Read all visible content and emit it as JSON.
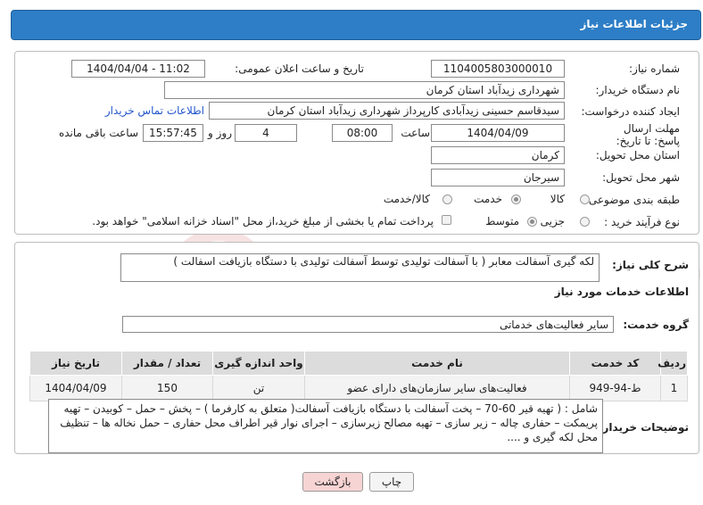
{
  "header": {
    "title": "جزئیات اطلاعات نیاز"
  },
  "fields": {
    "need_number_label": "شماره نیاز:",
    "need_number": "1104005803000010",
    "announce_label": "تاریخ و ساعت اعلان عمومی:",
    "announce_value": "1404/04/04 - 11:02",
    "buyer_org_label": "نام دستگاه خریدار:",
    "buyer_org": "شهرداری زیدآباد استان کرمان",
    "creator_label": "ایجاد کننده درخواست:",
    "creator": "سیدقاسم حسینی زیدآبادی کارپرداز شهرداری زیدآباد استان کرمان",
    "contact_link": "اطلاعات تماس خریدار",
    "deadline_label": "مهلت ارسال پاسخ: تا تاریخ:",
    "deadline_date": "1404/04/09",
    "time_label": "ساعت",
    "deadline_time": "08:00",
    "days_value": "4",
    "days_label": "روز و",
    "remaining_time": "15:57:45",
    "remaining_label": "ساعت باقی مانده",
    "province_label": "استان محل تحویل:",
    "province": "کرمان",
    "city_label": "شهر محل تحویل:",
    "city": "سیرجان",
    "category_label": "طبقه بندی موضوعی:",
    "category_options": [
      "کالا",
      "خدمت",
      "کالا/خدمت"
    ],
    "process_label": "نوع فرآیند خرید :",
    "process_options": [
      "جزیی",
      "متوسط"
    ],
    "payment_note": "پرداخت تمام یا بخشی از مبلغ خرید،از محل \"اسناد خزانه اسلامی\" خواهد بود."
  },
  "summary": {
    "label": "شرح کلی نیاز:",
    "text": "لکه گیری آسفالت معابر ( با آسفالت تولیدی توسط آسفالت تولیدی با دستگاه بازیافت اسفالت )"
  },
  "services": {
    "section_title": "اطلاعات خدمات مورد نیاز",
    "group_label": "گروه خدمت:",
    "group_value": "سایر فعالیت‌های خدماتی",
    "columns": [
      "ردیف",
      "کد خدمت",
      "نام خدمت",
      "واحد اندازه گیری",
      "تعداد / مقدار",
      "تاریخ نیاز"
    ],
    "rows": [
      [
        "1",
        "ط-94-949",
        "فعالیت‌های سایر سازمان‌های دارای عضو",
        "تن",
        "150",
        "1404/04/09"
      ]
    ]
  },
  "buyer_notes": {
    "label": "توضیحات خریدار:",
    "text": "شامل : ( تهیه قیر 60-70 – پخت آسفالت با دستگاه بازیافت آسفالت( متعلق به کارفرما ) – پخش – حمل – کوبیدن – تهیه پریمکت – حفاری چاله – زیر سازی – تهیه مصالح زیرسازی – اجرای نوار قیر اطراف محل حفاری – حمل نخاله ها – تنظیف محل لکه گیری و ...."
  },
  "buttons": {
    "print": "چاپ",
    "back": "بازگشت"
  },
  "colors": {
    "header": "#2d7ec6",
    "back_button": "#f7d4d4",
    "watermark": "#c62828"
  }
}
